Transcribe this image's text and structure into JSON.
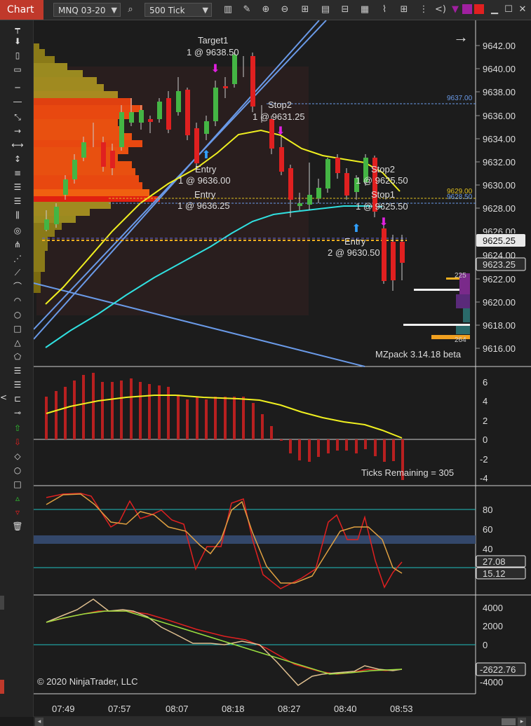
{
  "tab": {
    "title": "Chart"
  },
  "toolbar": {
    "instrument": "MNQ 03-20",
    "interval": "500 Tick"
  },
  "price_axis": {
    "ticks": [
      "9642.00",
      "9640.00",
      "9638.00",
      "9636.00",
      "9634.00",
      "9632.00",
      "9630.00",
      "9628.00",
      "9624.00",
      "9622.00",
      "9620.00",
      "9618.00",
      "9616.00"
    ],
    "current_price": "9625.25",
    "last_price": "9623.25",
    "stop_ref": "9637.00",
    "target_ref_1": "9629.00",
    "target_ref_2": "9628.50",
    "hidden_tick": "9626.00"
  },
  "annotations": {
    "target1_label": "Target1",
    "target1_order": "1 @ 9638.50",
    "stop2a_label": "Stop2",
    "stop2a_order": "1 @ 9631.25",
    "entry1_label": "Entry",
    "entry1_order": "1 @ 9636.00",
    "entry2_label": "Entry",
    "entry2_order": "1 @ 9636.25",
    "stop2b_label": "Stop2",
    "stop2b_order": "1 @ 9625.50",
    "stop1_label": "Stop1",
    "stop1_order": "1 @ 9625.50",
    "entry3_label": "Entry",
    "entry3_order": "2 @ 9630.50",
    "vp_top": "225",
    "vp_bottom": "264",
    "mzpack": "MZpack 3.14.18 beta",
    "ticks_remaining": "Ticks Remaining = 305",
    "copyright": "© 2020 NinjaTrader, LLC"
  },
  "osc1_axis": [
    "6",
    "4",
    "2",
    "0",
    "-2",
    "-4"
  ],
  "osc2_axis": [
    "80",
    "60",
    "40"
  ],
  "osc2_values": {
    "v1": "27.08",
    "v2": "15.12"
  },
  "osc3_axis": [
    "4000",
    "2000",
    "0",
    "-4000"
  ],
  "osc3_value": "-2622.76",
  "time_axis": [
    "07:49",
    "07:57",
    "08:07",
    "08:18",
    "08:27",
    "08:40",
    "08:53"
  ],
  "colors": {
    "bull": "#44b544",
    "bear": "#e02020",
    "ma_yellow": "#f0f020",
    "ma_cyan": "#30e0e0",
    "trendline": "#6a9ae8",
    "accent_red": "#c0392b"
  },
  "icons": [
    "search-icon",
    "pencil-icon",
    "zoom-in-icon",
    "zoom-out-icon",
    "crosshair-icon",
    "properties-icon",
    "strategy-icon",
    "indicators-icon",
    "grid-icon",
    "menu-icon",
    "arrow-right-icon"
  ]
}
